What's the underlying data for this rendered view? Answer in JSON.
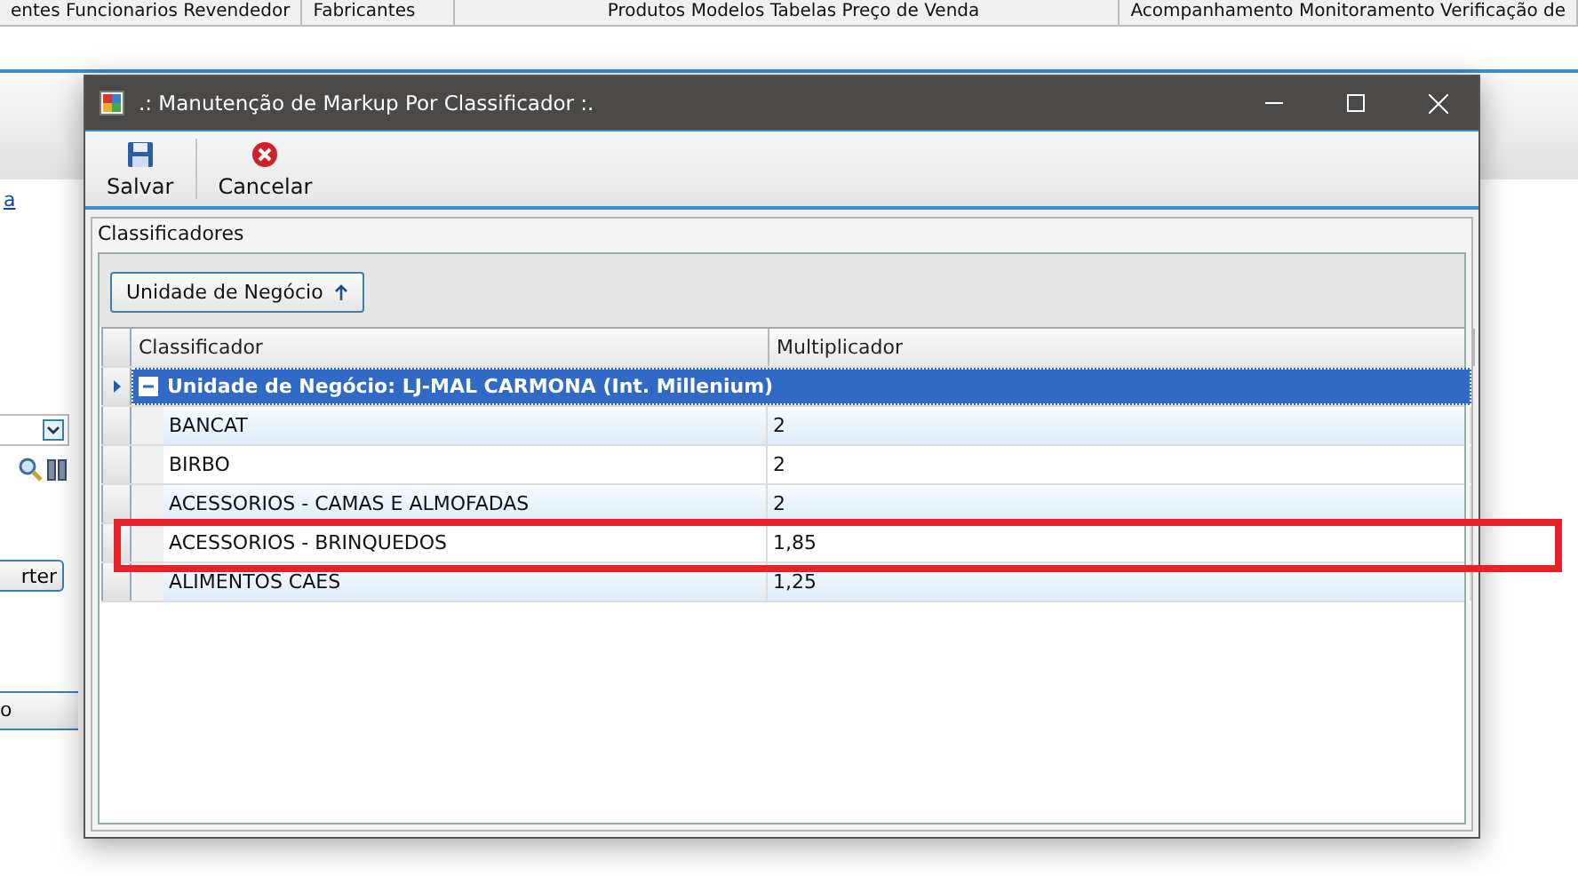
{
  "background": {
    "menu_groups": [
      "entes  Funcionarios  Revendedor",
      "Fabricantes",
      "Produtos  Modelos  Tabelas  Preço de Venda",
      "Acompanhamento  Monitoramento  Verificação de"
    ],
    "link": "a",
    "button": "rter",
    "tab": "o"
  },
  "window": {
    "title": ".: Manutenção de Markup Por Classificador :.",
    "toolbar": [
      {
        "label": "Salvar",
        "kind": "save"
      },
      {
        "label": "Cancelar",
        "kind": "cancel"
      }
    ],
    "group_title": "Classificadores",
    "group_chip": "Unidade de Negócio",
    "grid": {
      "columns": [
        "Classificador",
        "Multiplicador"
      ],
      "group_row": {
        "label": "Unidade de Negócio: LJ-MAL CARMONA (Int. Millenium)",
        "expanded": true,
        "selected": true
      },
      "rows": [
        {
          "classificador": "BANCAT",
          "multiplicador": "2",
          "highlighted": false
        },
        {
          "classificador": "BIRBO",
          "multiplicador": "2",
          "highlighted": false
        },
        {
          "classificador": "ACESSORIOS - CAMAS E ALMOFADAS",
          "multiplicador": "2",
          "highlighted": false
        },
        {
          "classificador": "ACESSORIOS - BRINQUEDOS",
          "multiplicador": "1,85",
          "highlighted": true
        },
        {
          "classificador": "ALIMENTOS CAES",
          "multiplicador": "1,25",
          "highlighted": false
        }
      ]
    }
  }
}
